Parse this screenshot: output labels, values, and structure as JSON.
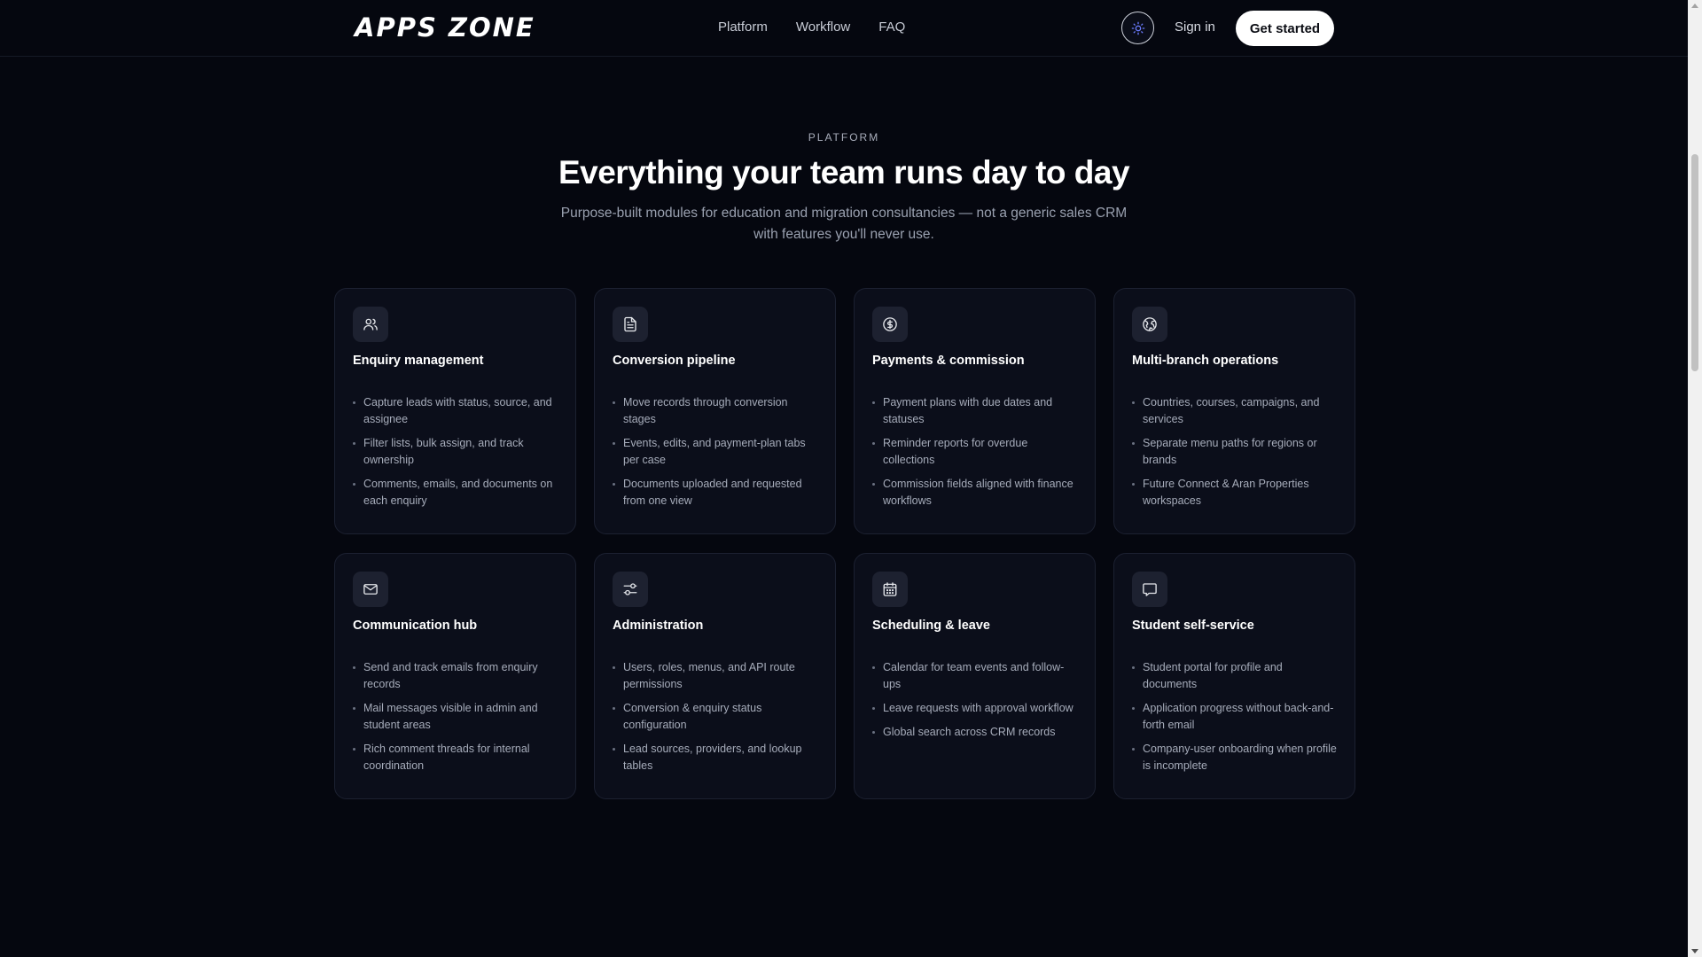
{
  "header": {
    "logo": "APPS ZONE",
    "nav": [
      "Platform",
      "Workflow",
      "FAQ"
    ],
    "theme_toggle_icon": "sun-icon",
    "sign_in": "Sign in",
    "get_started": "Get started"
  },
  "hero": {
    "eyebrow": "PLATFORM",
    "title": "Everything your team runs day to day",
    "subtitle": "Purpose-built modules for education and migration consultancies — not a generic sales CRM with features you'll never use."
  },
  "cards": [
    {
      "icon": "users-icon",
      "title": "Enquiry management",
      "items": [
        "Capture leads with status, source, and assignee",
        "Filter lists, bulk assign, and track ownership",
        "Comments, emails, and documents on each enquiry"
      ]
    },
    {
      "icon": "document-icon",
      "title": "Conversion pipeline",
      "items": [
        "Move records through conversion stages",
        "Events, edits, and payment-plan tabs per case",
        "Documents uploaded and requested from one view"
      ]
    },
    {
      "icon": "dollar-circle-icon",
      "title": "Payments & commission",
      "items": [
        "Payment plans with due dates and statuses",
        "Reminder reports for overdue collections",
        "Commission fields aligned with finance workflows"
      ]
    },
    {
      "icon": "globe-icon",
      "title": "Multi-branch operations",
      "items": [
        "Countries, courses, campaigns, and services",
        "Separate menu paths for regions or brands",
        "Future Connect & Aran Properties workspaces"
      ]
    },
    {
      "icon": "mail-icon",
      "title": "Communication hub",
      "items": [
        "Send and track emails from enquiry records",
        "Mail messages visible in admin and student areas",
        "Rich comment threads for internal coordination"
      ]
    },
    {
      "icon": "settings-sliders-icon",
      "title": "Administration",
      "items": [
        "Users, roles, menus, and API route permissions",
        "Conversion & enquiry status configuration",
        "Lead sources, providers, and lookup tables"
      ]
    },
    {
      "icon": "calendar-icon",
      "title": "Scheduling & leave",
      "items": [
        "Calendar for team events and follow-ups",
        "Leave requests with approval workflow",
        "Global search across CRM records"
      ]
    },
    {
      "icon": "chat-icon",
      "title": "Student self-service",
      "items": [
        "Student portal for profile and documents",
        "Application progress without back-and-forth email",
        "Company-user onboarding when profile is incomplete"
      ]
    }
  ]
}
